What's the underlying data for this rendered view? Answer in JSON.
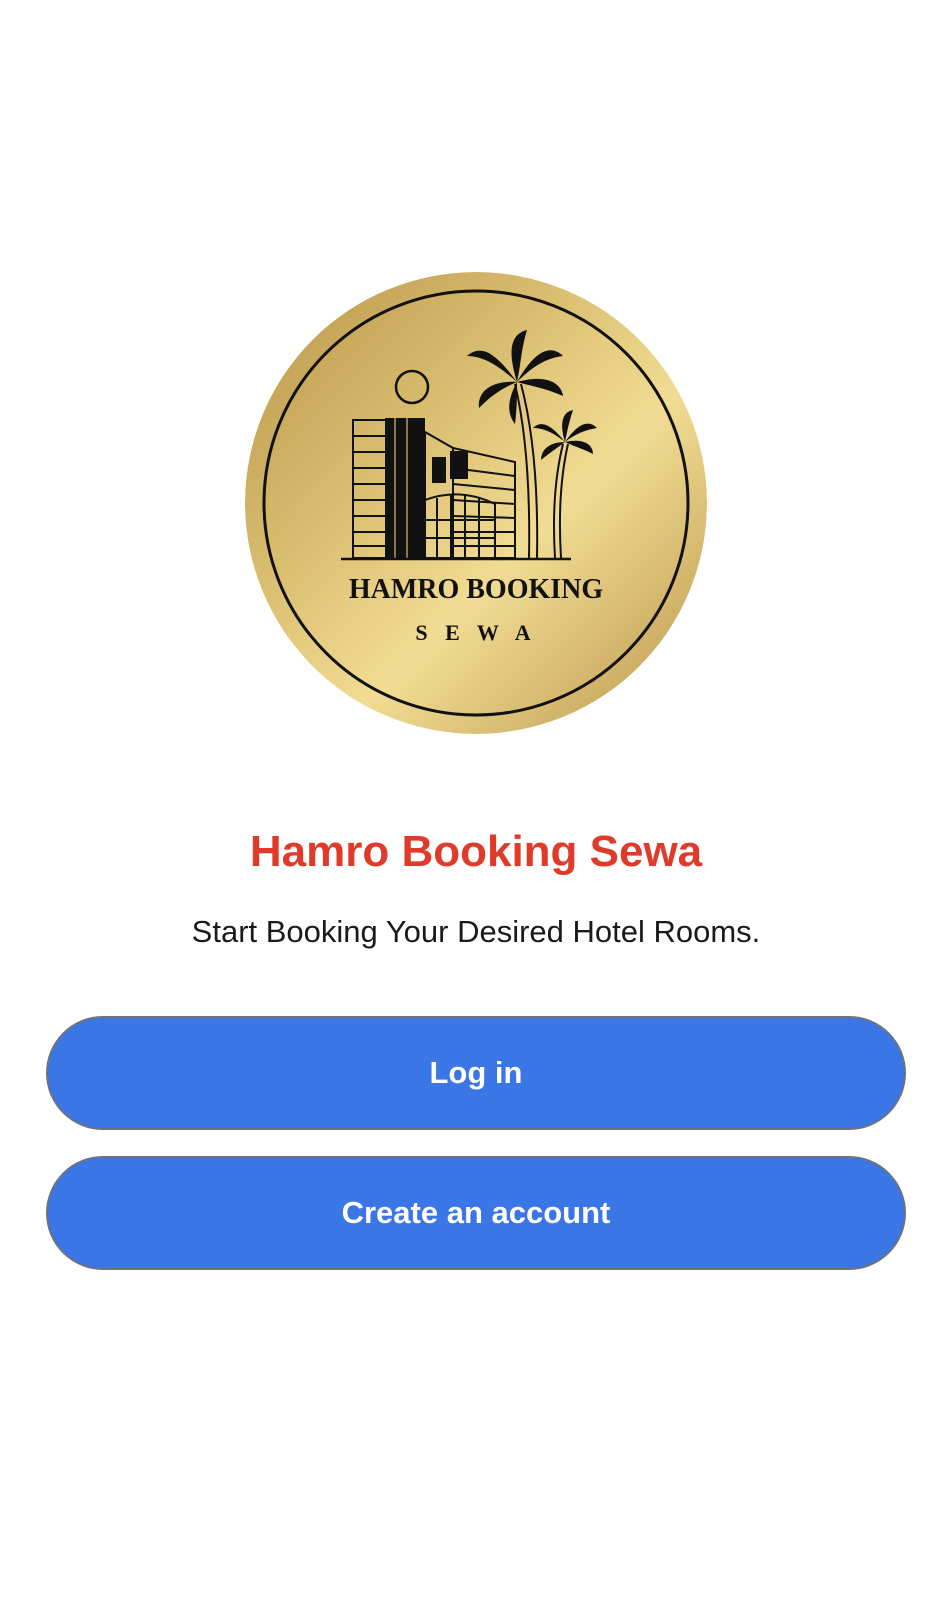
{
  "logo": {
    "line1": "HAMRO BOOKING",
    "line2": "S E W A",
    "icon": "hotel-building-palm-emblem",
    "colors": {
      "gold_light": "#f1dc93",
      "gold_mid": "#d9bd6f",
      "gold_dark": "#b8954a",
      "ink": "#111111"
    }
  },
  "welcome": {
    "title": "Hamro Booking Sewa",
    "subtitle": "Start Booking Your Desired Hotel Rooms.",
    "title_color": "#e03a2b"
  },
  "actions": {
    "login_label": "Log in",
    "create_label": "Create an account",
    "button_color": "#3a76e6"
  }
}
